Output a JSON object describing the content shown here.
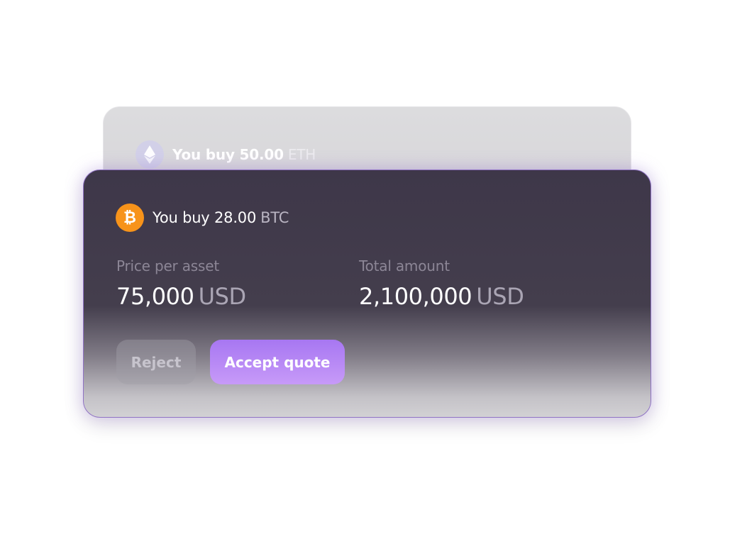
{
  "back_card": {
    "icon": "ethereum-icon",
    "title": "You buy 50.00",
    "unit": "ETH"
  },
  "front_card": {
    "icon": "bitcoin-icon",
    "icon_glyph": "₿",
    "title": "You buy 28.00",
    "unit": "BTC",
    "price": {
      "label": "Price per asset",
      "value": "75,000",
      "unit": "USD"
    },
    "total": {
      "label": "Total amount",
      "value": "2,100,000",
      "unit": "USD"
    },
    "reject_label": "Reject",
    "accept_label": "Accept quote"
  },
  "colors": {
    "accent": "#a777f2",
    "bitcoin": "#f7931a",
    "card_dark": "#3e3749"
  }
}
